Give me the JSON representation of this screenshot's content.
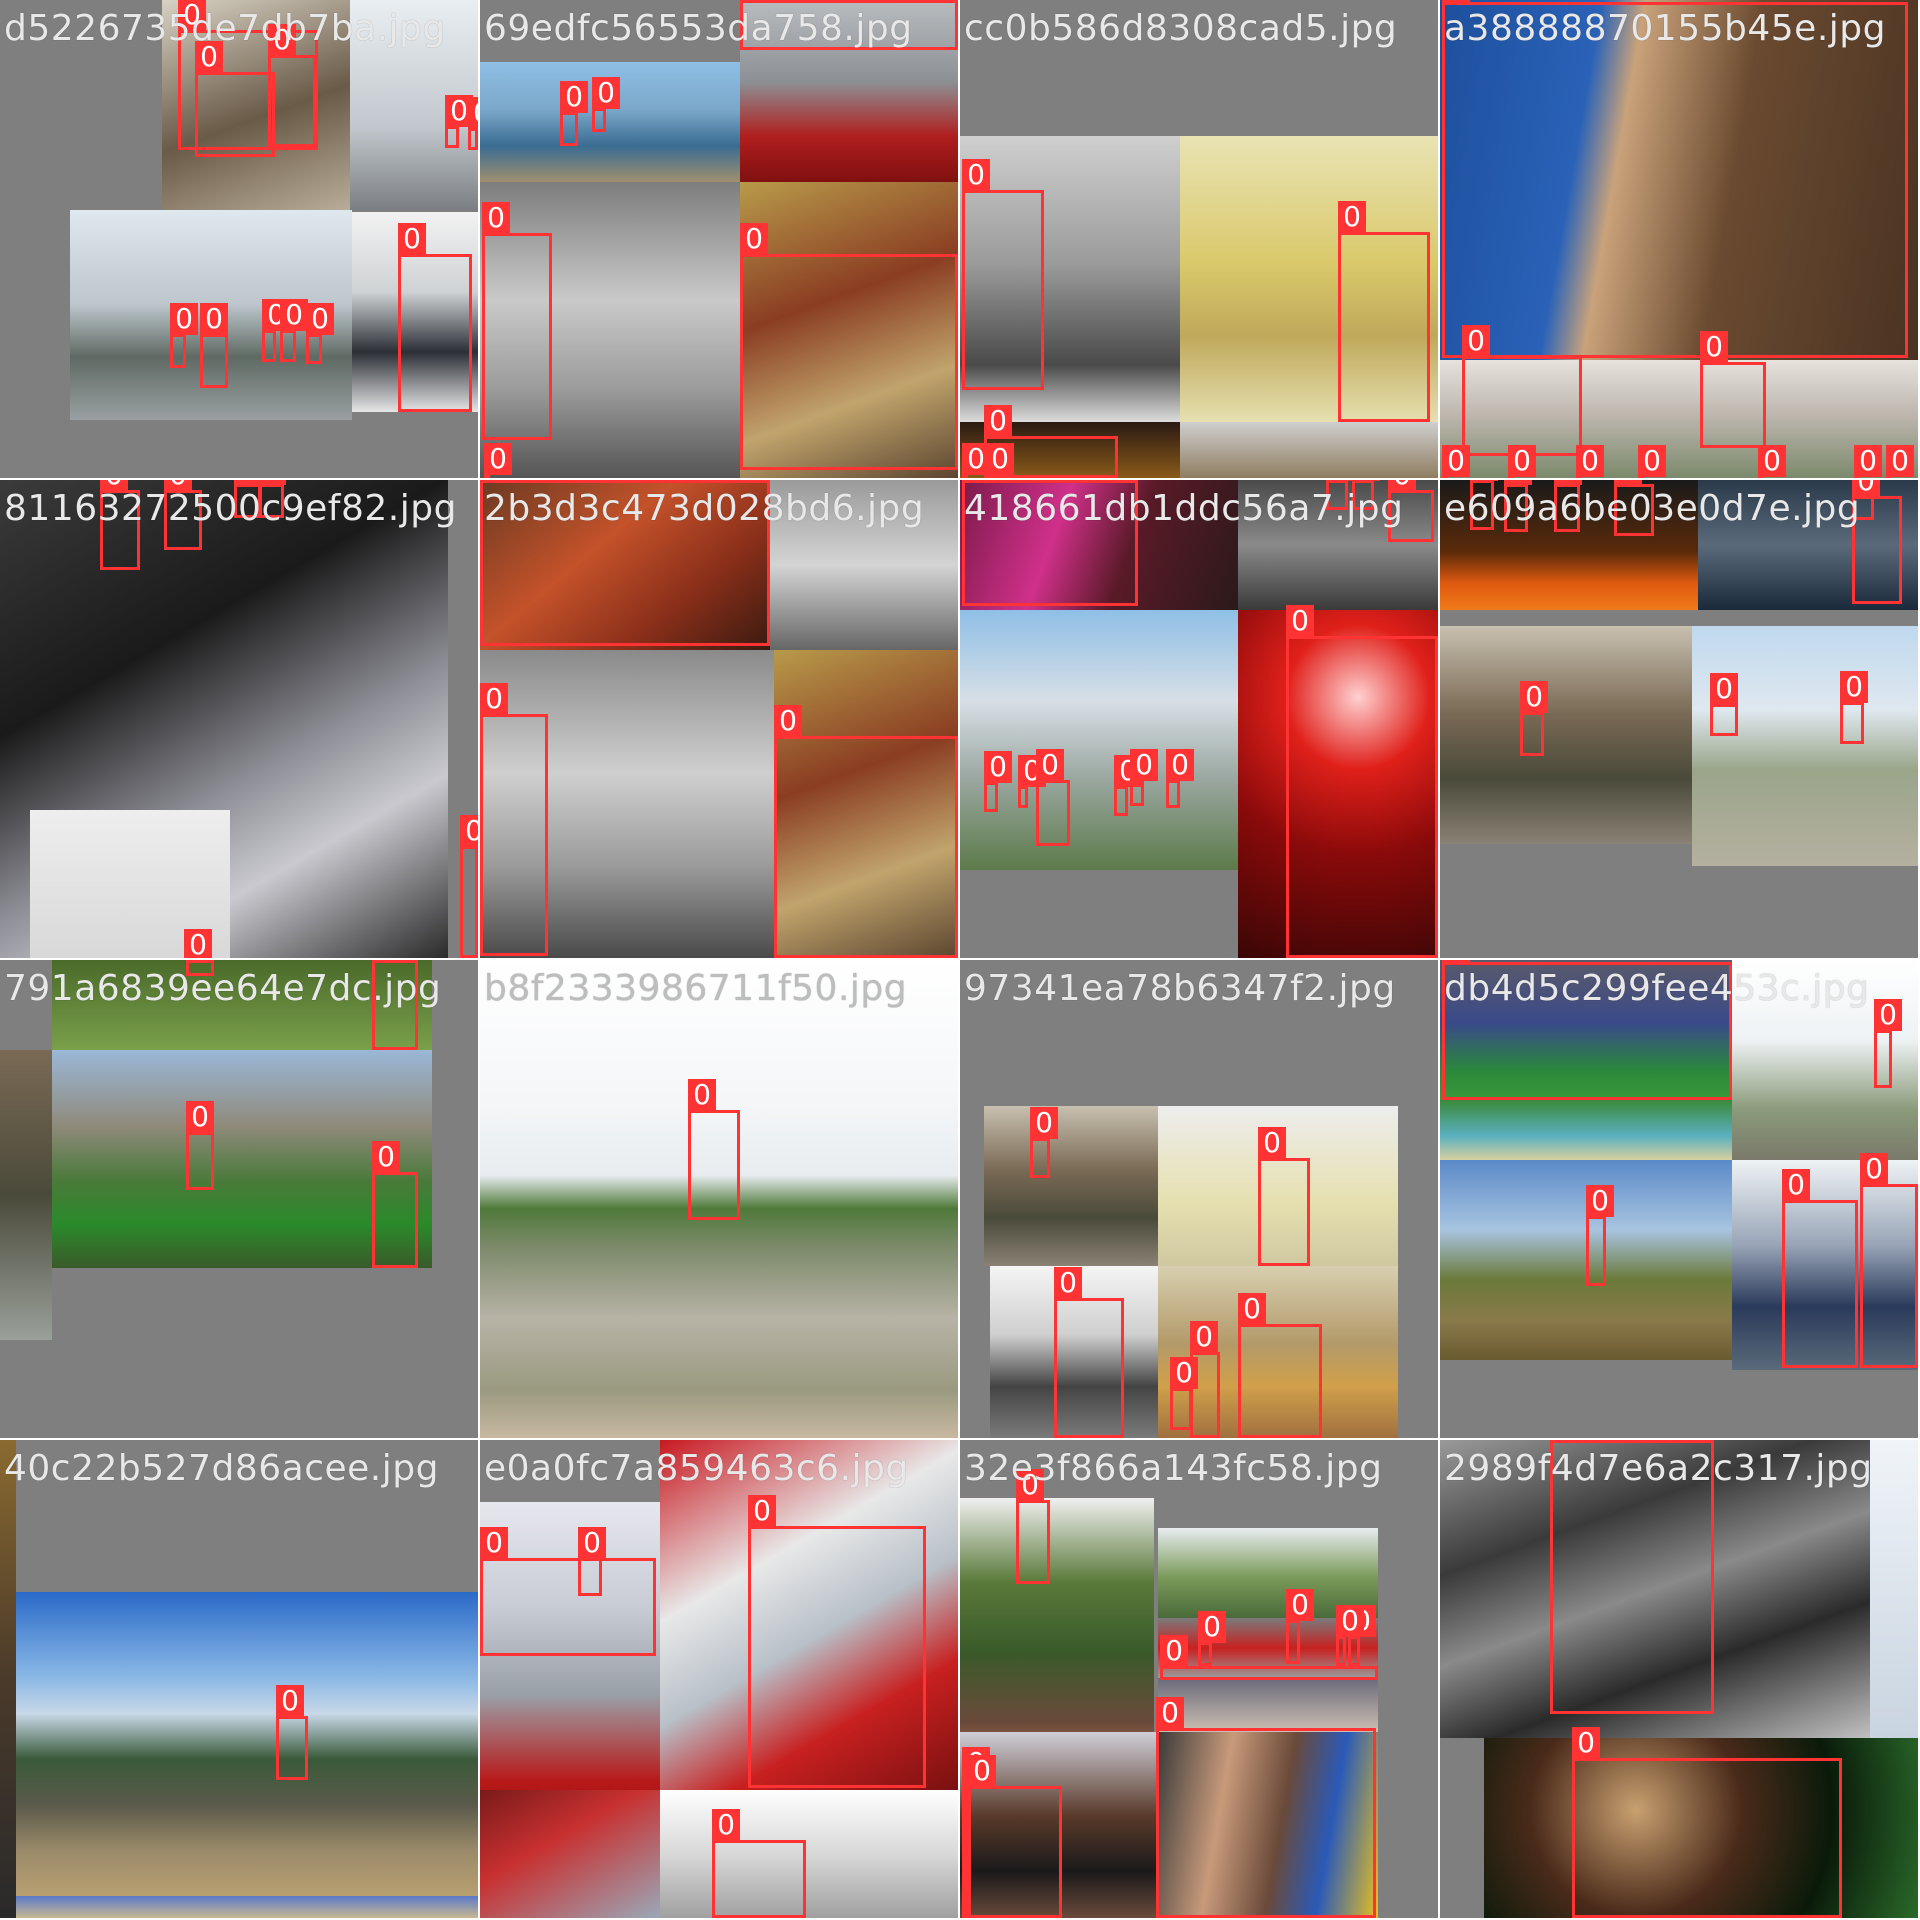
{
  "colors": {
    "box": "#ff3333",
    "tag_text": "#ffffff",
    "tile_bg": "#7f7f7f",
    "label_text": "#e8e8e8"
  },
  "box_label": "0",
  "tiles": [
    {
      "filename": "d5226735de7db7ba.jpg",
      "boxes": 11
    },
    {
      "filename": "69edfc56553da758.jpg",
      "boxes": 6
    },
    {
      "filename": "cc0b586d8308cad5.jpg",
      "boxes": 5
    },
    {
      "filename": "a38888870155b45e.jpg",
      "boxes": 10
    },
    {
      "filename": "81163272500c9ef82.jpg",
      "boxes": 6
    },
    {
      "filename": "2b3d3c473d028bd6.jpg",
      "boxes": 4
    },
    {
      "filename": "418661db1ddc56a7.jpg",
      "boxes": 11
    },
    {
      "filename": "e609a6be03e0d7e.jpg",
      "boxes": 9
    },
    {
      "filename": "791a6839ee64e7dc.jpg",
      "boxes": 4
    },
    {
      "filename": "b8f2333986711f50.jpg",
      "boxes": 1
    },
    {
      "filename": "97341ea78b6347f2.jpg",
      "boxes": 6
    },
    {
      "filename": "db4d5c299fee453c.jpg",
      "boxes": 5
    },
    {
      "filename": "40c22b527d86acee.jpg",
      "boxes": 1
    },
    {
      "filename": "e0a0fc7a859463c6.jpg",
      "boxes": 4
    },
    {
      "filename": "32e3f866a143fc58.jpg",
      "boxes": 9
    },
    {
      "filename": "2989f4d7e6a2c317.jpg",
      "boxes": 2
    }
  ]
}
